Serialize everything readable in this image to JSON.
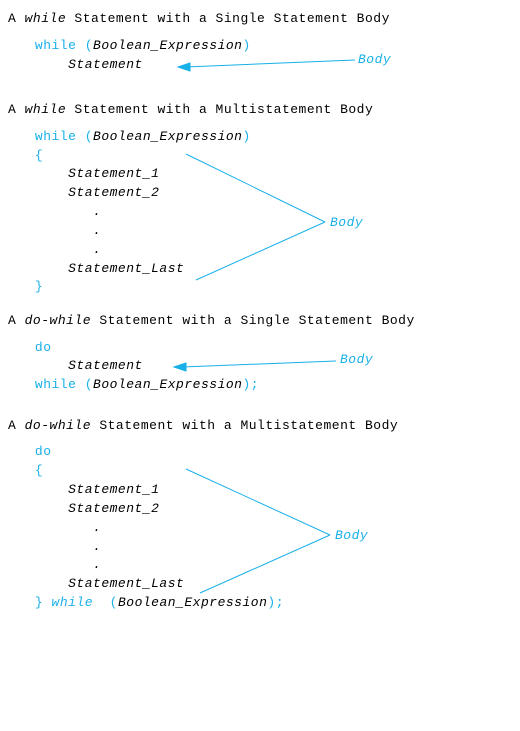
{
  "sec1": {
    "title_pre": "A ",
    "title_em": "while",
    "title_post": " Statement with a Single Statement Body",
    "kw_while": "while",
    "paren_open": "(",
    "expr": "Boolean_Expression",
    "paren_close": ")",
    "stmt": "Statement",
    "ann": "Body"
  },
  "sec2": {
    "title_pre": "A ",
    "title_em": "while",
    "title_post": " Statement with a Multistatement Body",
    "kw_while": "while",
    "paren_open": "(",
    "expr": "Boolean_Expression",
    "paren_close": ")",
    "brace_open": "{",
    "s1": "Statement_1",
    "s2": "Statement_2",
    "dot1": ".",
    "dot2": ".",
    "dot3": ".",
    "slast": "Statement_Last",
    "brace_close": "}",
    "ann": "Body"
  },
  "sec3": {
    "title_pre": "A ",
    "title_em": "do-while",
    "title_post": " Statement with a Single Statement Body",
    "kw_do": "do",
    "stmt": "Statement",
    "kw_while": "while",
    "paren_open": "(",
    "expr": "Boolean_Expression",
    "paren_close_semi": ");",
    "ann": "Body"
  },
  "sec4": {
    "title_pre": "A ",
    "title_em": "do-while",
    "title_post": " Statement with a Multistatement Body",
    "kw_do": "do",
    "brace_open": "{",
    "s1": "Statement_1",
    "s2": "Statement_2",
    "dot1": ".",
    "dot2": ".",
    "dot3": ".",
    "slast": "Statement_Last",
    "brace_close_pre": "}",
    "kw_while": "while",
    "paren_open": "(",
    "expr": "Boolean_Expression",
    "paren_close_semi": ");",
    "ann": "Body"
  }
}
